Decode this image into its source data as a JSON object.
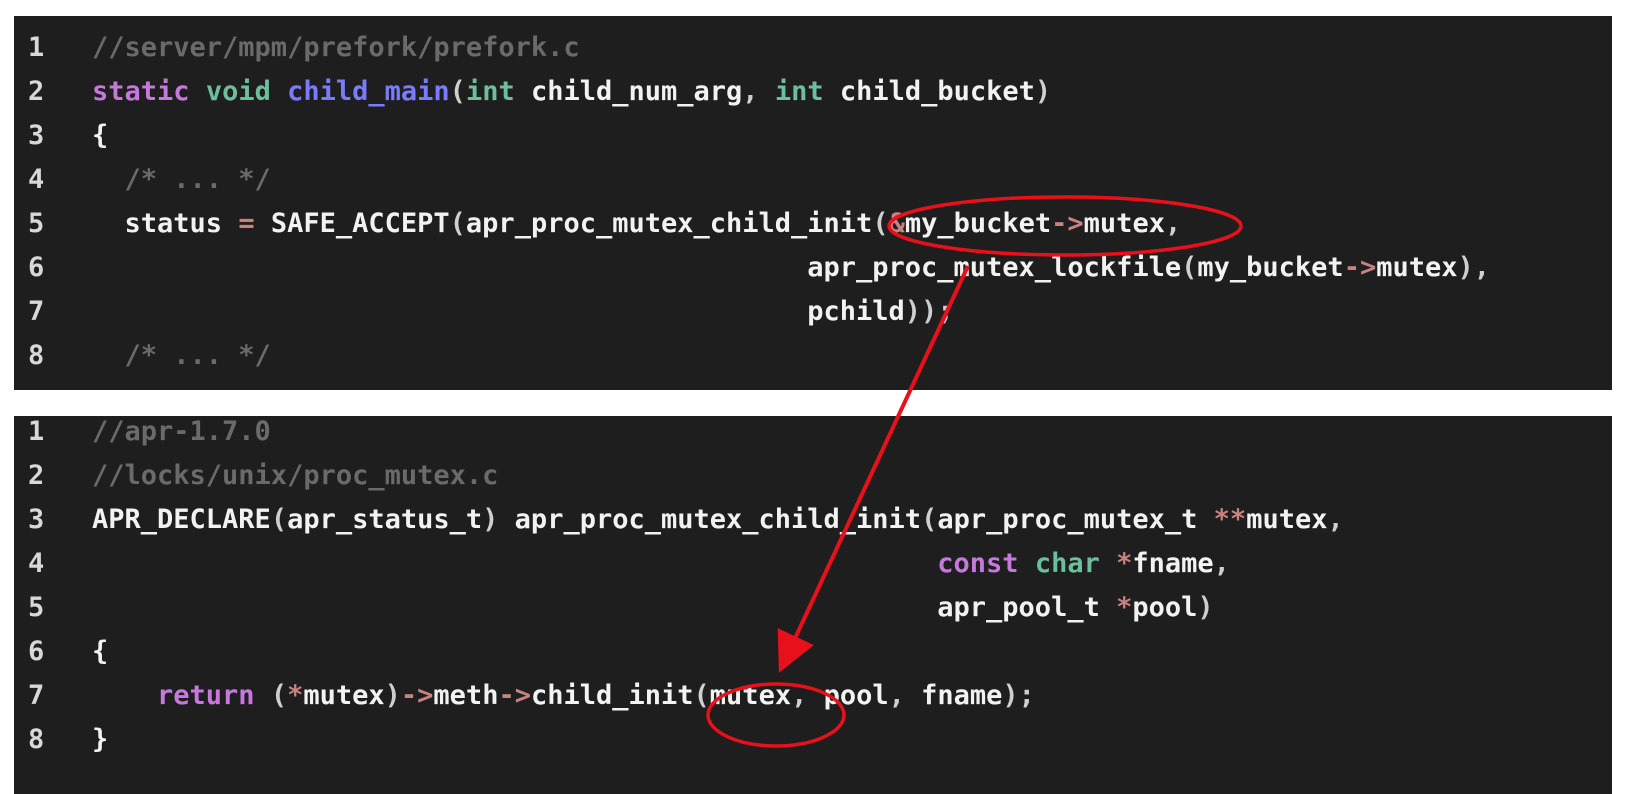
{
  "colors": {
    "background": "#1e1e1e",
    "comment": "#6a6a6a",
    "keyword": "#c678dd",
    "type": "#6dbf9c",
    "function": "#7a7cff",
    "operator": "#c98282",
    "text": "#f2f2f2",
    "annotation": "#e8101a"
  },
  "block_a": {
    "lines": [
      {
        "num": "1",
        "tokens": [
          {
            "t": "//server/mpm/prefork/prefork.c",
            "c": "comment"
          }
        ]
      },
      {
        "num": "2",
        "tokens": [
          {
            "t": "static",
            "c": "keyword"
          },
          {
            "t": " ",
            "c": "plain"
          },
          {
            "t": "void",
            "c": "type"
          },
          {
            "t": " ",
            "c": "plain"
          },
          {
            "t": "child_main",
            "c": "func"
          },
          {
            "t": "(",
            "c": "punct"
          },
          {
            "t": "int",
            "c": "type"
          },
          {
            "t": " child_num_arg",
            "c": "plain"
          },
          {
            "t": ", ",
            "c": "punct"
          },
          {
            "t": "int",
            "c": "type"
          },
          {
            "t": " child_bucket",
            "c": "plain"
          },
          {
            "t": ")",
            "c": "punct"
          }
        ]
      },
      {
        "num": "3",
        "tokens": [
          {
            "t": "{",
            "c": "plain"
          }
        ]
      },
      {
        "num": "4",
        "tokens": [
          {
            "t": "  /* ... */",
            "c": "comment"
          }
        ]
      },
      {
        "num": "5",
        "tokens": [
          {
            "t": "  status ",
            "c": "plain"
          },
          {
            "t": "=",
            "c": "op"
          },
          {
            "t": " SAFE_ACCEPT",
            "c": "plain"
          },
          {
            "t": "(",
            "c": "punct"
          },
          {
            "t": "apr_proc_mutex_child_init",
            "c": "plain"
          },
          {
            "t": "(",
            "c": "punct"
          },
          {
            "t": "&",
            "c": "op"
          },
          {
            "t": "my_bucket",
            "c": "plain"
          },
          {
            "t": "->",
            "c": "op"
          },
          {
            "t": "mutex",
            "c": "plain"
          },
          {
            "t": ",",
            "c": "punct"
          }
        ]
      },
      {
        "num": "6",
        "tokens": [
          {
            "t": "                                            apr_proc_mutex_lockfile",
            "c": "plain"
          },
          {
            "t": "(",
            "c": "punct"
          },
          {
            "t": "my_bucket",
            "c": "plain"
          },
          {
            "t": "->",
            "c": "op"
          },
          {
            "t": "mutex",
            "c": "plain"
          },
          {
            "t": "),",
            "c": "punct"
          }
        ]
      },
      {
        "num": "7",
        "tokens": [
          {
            "t": "                                            pchild",
            "c": "plain"
          },
          {
            "t": "));",
            "c": "punct"
          }
        ]
      },
      {
        "num": "8",
        "tokens": [
          {
            "t": "  /* ... */",
            "c": "comment"
          }
        ]
      }
    ]
  },
  "block_b": {
    "lines": [
      {
        "num": "1",
        "tokens": [
          {
            "t": "//apr-1.7.0",
            "c": "comment"
          }
        ]
      },
      {
        "num": "2",
        "tokens": [
          {
            "t": "//locks/unix/proc_mutex.c",
            "c": "comment"
          }
        ]
      },
      {
        "num": "3",
        "tokens": [
          {
            "t": "APR_DECLARE",
            "c": "plain"
          },
          {
            "t": "(",
            "c": "punct"
          },
          {
            "t": "apr_status_t",
            "c": "plain"
          },
          {
            "t": ")",
            "c": "punct"
          },
          {
            "t": " apr_proc_mutex_child_init",
            "c": "plain"
          },
          {
            "t": "(",
            "c": "punct"
          },
          {
            "t": "apr_proc_mutex_t ",
            "c": "plain"
          },
          {
            "t": "**",
            "c": "op"
          },
          {
            "t": "mutex",
            "c": "plain"
          },
          {
            "t": ",",
            "c": "punct"
          }
        ]
      },
      {
        "num": "4",
        "tokens": [
          {
            "t": "                                                    ",
            "c": "plain"
          },
          {
            "t": "const",
            "c": "keyword"
          },
          {
            "t": " ",
            "c": "plain"
          },
          {
            "t": "char",
            "c": "type"
          },
          {
            "t": " ",
            "c": "plain"
          },
          {
            "t": "*",
            "c": "op"
          },
          {
            "t": "fname",
            "c": "plain"
          },
          {
            "t": ",",
            "c": "punct"
          }
        ]
      },
      {
        "num": "5",
        "tokens": [
          {
            "t": "                                                    apr_pool_t ",
            "c": "plain"
          },
          {
            "t": "*",
            "c": "op"
          },
          {
            "t": "pool",
            "c": "plain"
          },
          {
            "t": ")",
            "c": "punct"
          }
        ]
      },
      {
        "num": "6",
        "tokens": [
          {
            "t": "{",
            "c": "plain"
          }
        ]
      },
      {
        "num": "7",
        "tokens": [
          {
            "t": "    ",
            "c": "plain"
          },
          {
            "t": "return",
            "c": "keyword"
          },
          {
            "t": " (",
            "c": "punct"
          },
          {
            "t": "*",
            "c": "op"
          },
          {
            "t": "mutex",
            "c": "plain"
          },
          {
            "t": ")",
            "c": "punct"
          },
          {
            "t": "->",
            "c": "op"
          },
          {
            "t": "meth",
            "c": "plain"
          },
          {
            "t": "->",
            "c": "op"
          },
          {
            "t": "child_init",
            "c": "plain"
          },
          {
            "t": "(",
            "c": "punct"
          },
          {
            "t": "mutex",
            "c": "plain"
          },
          {
            "t": ", ",
            "c": "punct"
          },
          {
            "t": "pool",
            "c": "plain"
          },
          {
            "t": ", ",
            "c": "punct"
          },
          {
            "t": "fname",
            "c": "plain"
          },
          {
            "t": ");",
            "c": "punct"
          }
        ]
      },
      {
        "num": "8",
        "tokens": [
          {
            "t": "}",
            "c": "plain"
          }
        ]
      }
    ]
  }
}
